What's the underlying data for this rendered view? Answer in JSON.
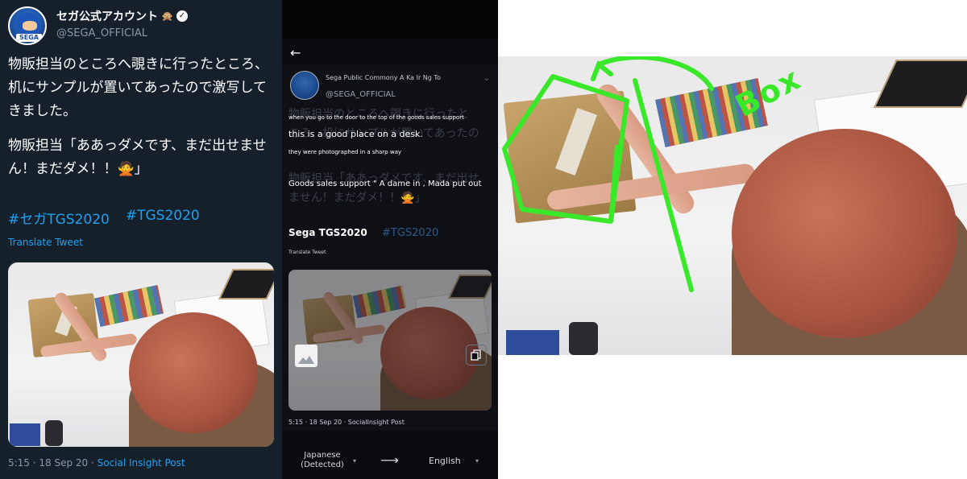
{
  "tweet": {
    "display_name": "セガ公式アカウント",
    "name_emoji": "🙊",
    "handle": "@SEGA_OFFICIAL",
    "avatar_badge": "SEGA",
    "body_line_1": "物販担当のところへ覗きに行ったところ、机にサンプルが置いてあったので激写してきました。",
    "body_line_2": "物販担当「ああっダメです、まだ出せません！まだダメ！！🙅」",
    "hashtag_1": "#セガTGS2020",
    "hashtag_2": "#TGS2020",
    "translate_label": "Translate Tweet",
    "time": "5:15 · 18 Sep 20 · ",
    "source": "Social Insight Post"
  },
  "phone": {
    "ghost_name": "Sega Public Commony A Ka Ir Ng To",
    "handle": "@SEGA_OFFICIAL",
    "overlay_1": "when you go to the door to the top of the goods sales support",
    "overlay_2": "this is a good place on a desk.",
    "overlay_3": "they were photographed in a sharp way",
    "overlay_4": "Goods sales support \" A dame in , Mada put out",
    "ghost_line_1": "物販担当のところへ覗きに行ったと",
    "ghost_line_2": "ころ、机にサンプルが置いてあったの",
    "ghost_line_4": "物販担当「ああっダメです、まだ出せ",
    "ghost_line_5": "ません！まだダメ！！🙅」",
    "hashtag_1": "Sega TGS2020",
    "hashtag_2": "#TGS2020",
    "translate_label": "Translate Tweet",
    "meta": "5:15 · 18 Sep 20 · SocialInsight Post",
    "source_lang": "Japanese (Detected)",
    "target_lang": "English"
  },
  "annotation": {
    "label": "Box",
    "stroke_color": "#3ae82a"
  }
}
